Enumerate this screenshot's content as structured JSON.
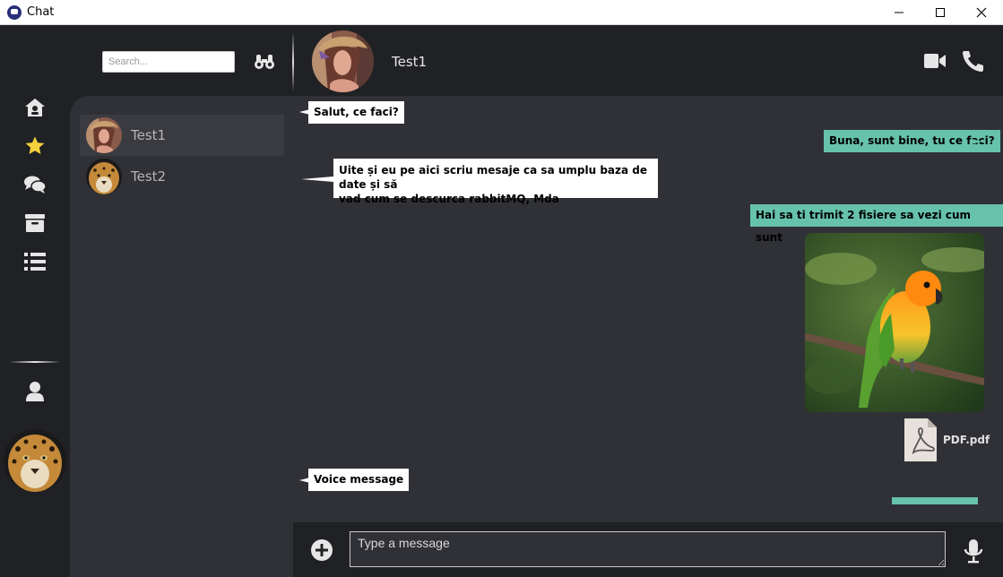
{
  "window": {
    "title": "Chat",
    "controls": [
      "minimize",
      "maximize",
      "close"
    ]
  },
  "rail": {
    "icons": [
      "home-icon",
      "star-icon",
      "chat-bubbles-icon",
      "archive-icon",
      "list-icon",
      "user-icon"
    ],
    "accent_star_color": "#f5d23c",
    "profile_avatar": "jaguar"
  },
  "contacts": {
    "search_placeholder": "Search...",
    "search_icon": "binoculars-icon",
    "items": [
      {
        "name": "Test1",
        "avatar": "woman-portrait",
        "active": true
      },
      {
        "name": "Test2",
        "avatar": "jaguar",
        "active": false
      }
    ]
  },
  "chat": {
    "contact_name": "Test1",
    "actions": [
      "video-call-icon",
      "phone-icon"
    ],
    "messages": [
      {
        "direction": "in",
        "text": "Salut, ce faci?"
      },
      {
        "direction": "out",
        "text": "Buna, sunt bine, tu ce faci?"
      },
      {
        "direction": "in",
        "line1": "Uite și eu pe aici scriu mesaje ca sa umplu baza de date și să",
        "line2": "vad cum se descurca rabbitMQ, Mda"
      },
      {
        "direction": "out",
        "text": "Hai sa ti trimit 2 fisiere sa vezi cum sunt"
      },
      {
        "direction": "out",
        "type": "image",
        "alt": "parrot"
      },
      {
        "direction": "out",
        "type": "file",
        "filename": "PDF.pdf"
      },
      {
        "direction": "in",
        "text": "Voice message"
      },
      {
        "direction": "out",
        "type": "voice"
      }
    ]
  },
  "composer": {
    "placeholder": "Type a message",
    "attach_icon": "plus-circle-icon",
    "mic_icon": "microphone-icon"
  },
  "colors": {
    "background": "#202124",
    "panel": "#303136",
    "incoming_bubble": "#ffffff",
    "outgoing_bubble": "#66c2ab"
  }
}
